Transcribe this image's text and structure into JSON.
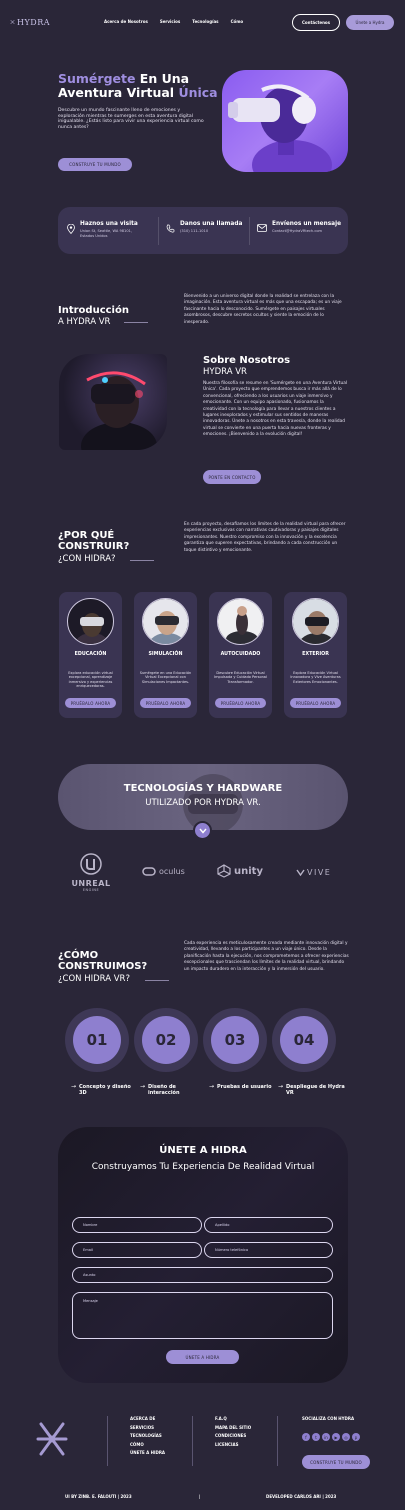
{
  "header": {
    "logo": "HYDRA",
    "nav": [
      "Acerca de Nosotros",
      "Servicios",
      "Tecnologías",
      "Cómo"
    ],
    "contact_btn": "Contáctenos",
    "join_btn": "Únete a Hydra"
  },
  "hero": {
    "title_accent_1": "Sumérgete",
    "title_1": " En Una",
    "title_2": "Aventura Virtual ",
    "title_accent_2": "Única",
    "description": "Descubre un mundo fascinante lleno de emociones y exploración mientras te sumerges en esta aventura digital inigualable. ¿Estás listo para vivir una experiencia virtual como nunca antes?",
    "cta": "CONSTRUYE TU MUNDO"
  },
  "contact": [
    {
      "title": "Haznos una visita",
      "sub": "Union St, Seattle, WA 98101, Estados Unidos",
      "icon": "location-pin-icon"
    },
    {
      "title": "Danos una llamada",
      "sub": "(310) 111-1010",
      "icon": "phone-icon"
    },
    {
      "title": "Envíenos un mensaje",
      "sub": "Contact@HydraVRtech.com",
      "icon": "mail-icon"
    }
  ],
  "intro": {
    "heading": "Introducción",
    "sub": "A HYDRA VR",
    "text": "Bienvenido a un universo digital donde la realidad se entrelaza con la imaginación. Esta aventura virtual es más que una escapada; es un viaje fascinante hacia lo desconocido. Sumérgete en paisajes virtuales asombrosos, descubre secretos ocultos y siente la emoción de lo inesperado."
  },
  "about": {
    "heading": "Sobre Nosotros",
    "sub": "HYDRA VR",
    "text": "Nuestra filosofía se resume en 'Sumérgete en una Aventura Virtual Única'. Cada proyecto que emprendemos busca ir más allá de lo convencional, ofreciendo a los usuarios un viaje inmersivo y emocionante. Con un equipo apasionado, fusionamos la creatividad con la tecnología para llevar a nuestros clientes a lugares inexplorados y estimular sus sentidos de maneras innovadoras. Únete a nosotros en esta travesía, donde la realidad virtual se convierte en una puerta hacia nuevas fronteras y emociones. ¡Bienvenido a la evolución digital!",
    "cta": "PONTE EN CONTACTO"
  },
  "why": {
    "heading_1": "¿POR QUÉ",
    "heading_2": "CONSTRUIR?",
    "sub": "¿CON HIDRA?",
    "text": "En cada proyecto, desafiamos los límites de la realidad virtual para ofrecer experiencias exclusivas con narrativas cautivadoras y paisajes digitales impresionantes. Nuestro compromiso con la innovación y la excelencia garantiza que superen expectativas, brindando a cada construcción un toque distintivo y emocionante."
  },
  "cards": [
    {
      "title": "EDUCACIÓN",
      "desc": "Explora educación virtual excepcional, aprendizaje inmersivo y experiencias enriquecedoras.",
      "btn": "PRUÉBALO AHORA"
    },
    {
      "title": "SIMULACIÓN",
      "desc": "Sumérgete en una Educación Virtual Excepcional con Simulaciones Impactantes.",
      "btn": "PRUÉBALO AHORA"
    },
    {
      "title": "AUTOCUIDADO",
      "desc": "Descubre Educación Virtual Impulsada y Cuidado Personal Transformador.",
      "btn": "PRUÉBALO AHORA"
    },
    {
      "title": "EXTERIOR",
      "desc": "Explora Educación Virtual Innovadora y Vive Aventuras Exteriores Emocionantes.",
      "btn": "PRUÉBALO AHORA"
    }
  ],
  "tech": {
    "title": "TECNOLOGÍAS Y HARDWARE",
    "sub": "UTILIZADO POR HYDRA VR.",
    "brands": [
      "UNREAL",
      "ENGINE",
      "oculus",
      "unity",
      "VIVE"
    ]
  },
  "how": {
    "heading_1": "¿CÓMO",
    "heading_2": "CONSTRUIMOS?",
    "sub": "¿CON HIDRA VR?",
    "text": "Cada experiencia es meticulosamente creada mediante innovación digital y creatividad, llevando a los participantes a un viaje único. Desde la planificación hasta la ejecución, nos comprometemos a ofrecer experiencias excepcionales que trasciendan los límites de la realidad virtual, brindando un impacto duradero en la interacción y la inmersión del usuario."
  },
  "steps": [
    {
      "num": "01",
      "label": "Concepto y diseño 3D"
    },
    {
      "num": "02",
      "label": "Diseño de interacción"
    },
    {
      "num": "03",
      "label": "Pruebas de usuario"
    },
    {
      "num": "04",
      "label": "Despliegue de Hydra VR"
    }
  ],
  "form": {
    "title": "ÚNETE A HIDRA",
    "sub": "Construyamos Tu Experiencia De Realidad Virtual",
    "placeholders": {
      "first": "Nombre",
      "last": "Apellido",
      "email": "Email",
      "phone": "Número telefónico",
      "subject": "Asunto",
      "message": "Mensaje"
    },
    "submit": "ÚNETE A HIDRA"
  },
  "footer": {
    "col1": [
      "ACERCA DE",
      "SERVICIOS",
      "TECNOLOGÍAS",
      "CÓMO",
      "ÚNETE A HIDRA"
    ],
    "col2": [
      "F.A.Q",
      "MAPA DEL SITIO",
      "CONDICIONES",
      "LICENCIAS"
    ],
    "social_title": "SOCIALIZA CON HYDRA",
    "social_cta": "CONSTRUYE TU MUNDO",
    "left_bottom": "UI BY ZINB. E. FALOUTI | 2023",
    "divider": "|",
    "right_bottom": "DEVELOPED CARLOS ARI | 2023"
  },
  "colors": {
    "background": "#2a2638",
    "accent": "#9f8ee0",
    "card": "#3a3452"
  }
}
